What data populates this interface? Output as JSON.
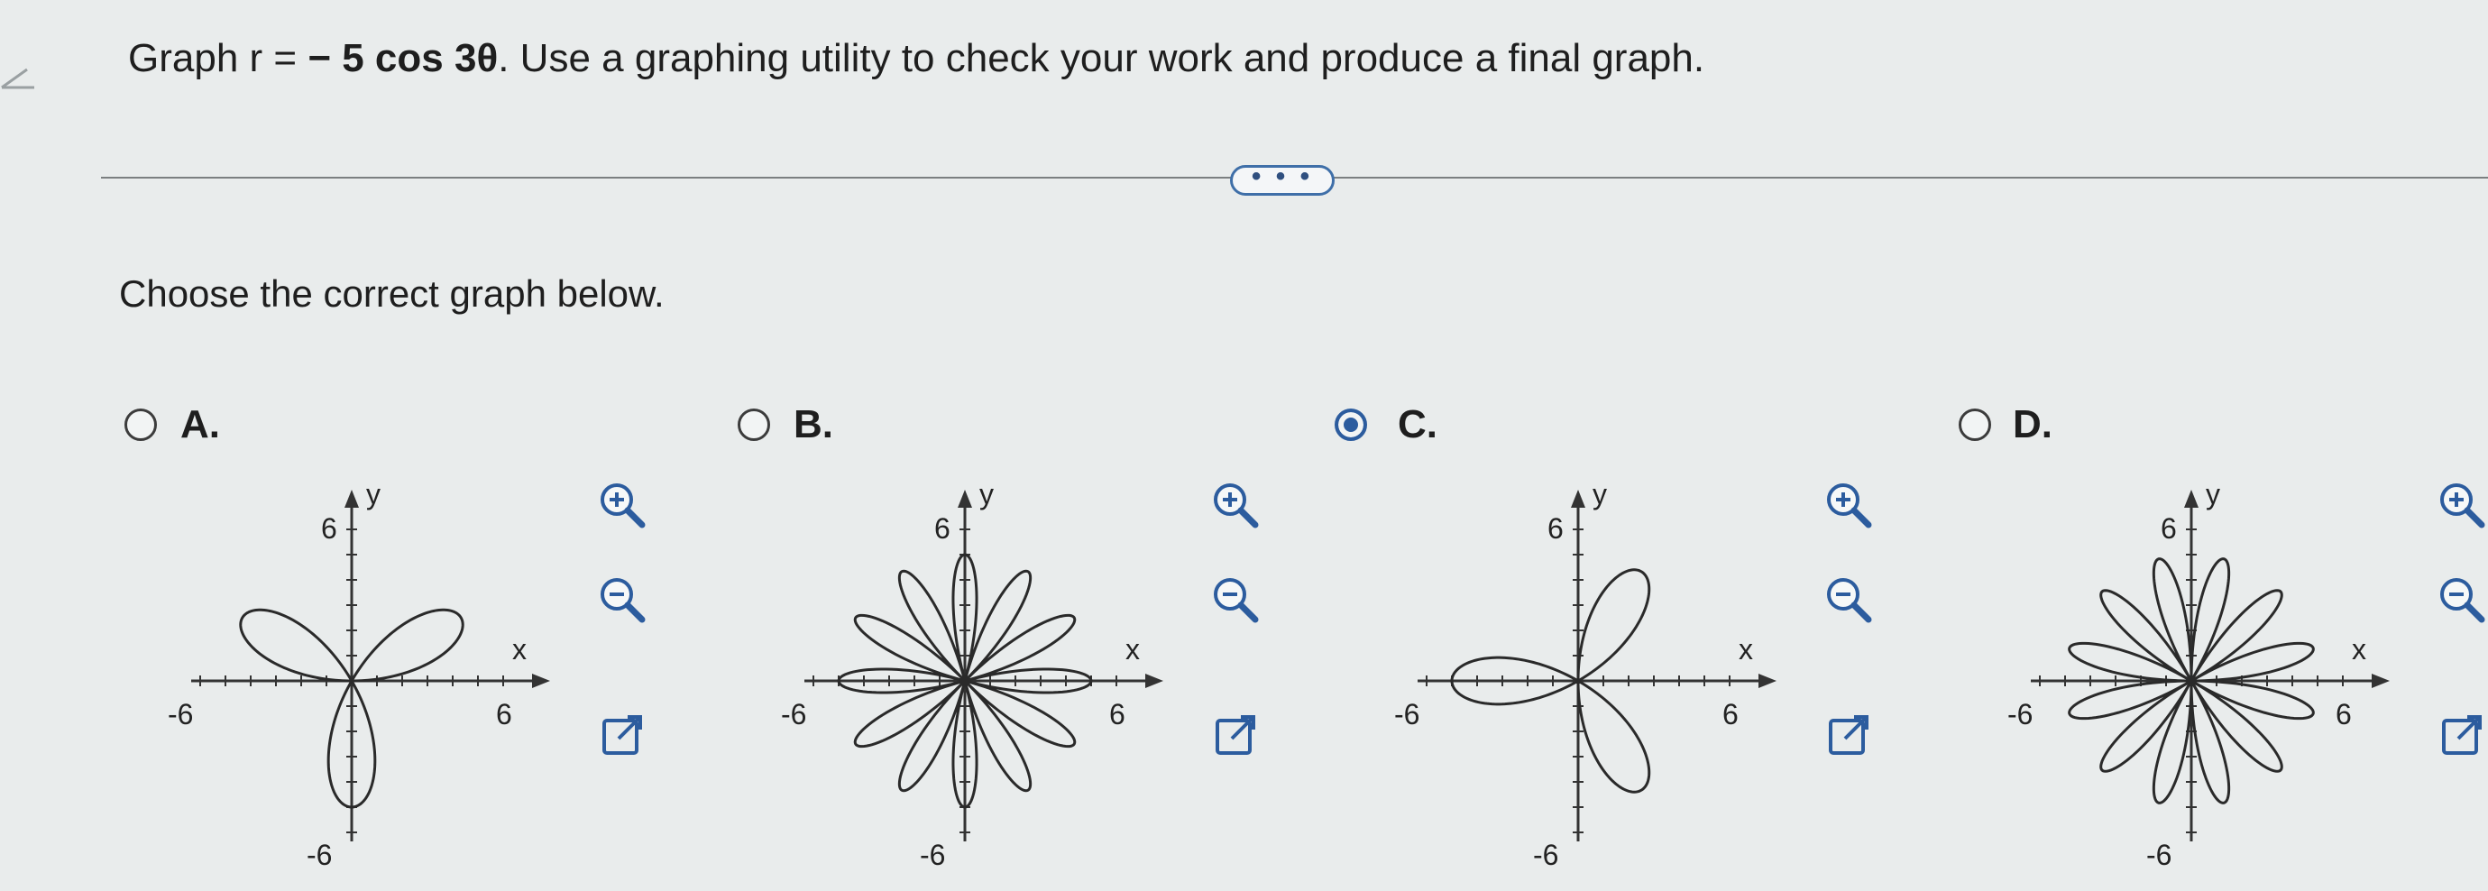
{
  "question": {
    "prefix": "Graph r = ",
    "equation": "− 5 cos 3θ",
    "suffix": ". Use a graphing utility to check your work and produce a final graph."
  },
  "more_button_label": "• • •",
  "prompt": "Choose the correct graph below.",
  "options": [
    {
      "letter": "A.",
      "selected": false
    },
    {
      "letter": "B.",
      "selected": false
    },
    {
      "letter": "C.",
      "selected": true
    },
    {
      "letter": "D.",
      "selected": false
    }
  ],
  "graph_labels": {
    "x": "x",
    "y": "y",
    "pos": "6",
    "neg": "-6"
  },
  "colors": {
    "accent": "#2c5c9e",
    "curve": "#2a2a2a"
  },
  "icons": [
    "zoom-in-icon",
    "zoom-out-icon",
    "open-new-window-icon"
  ]
}
